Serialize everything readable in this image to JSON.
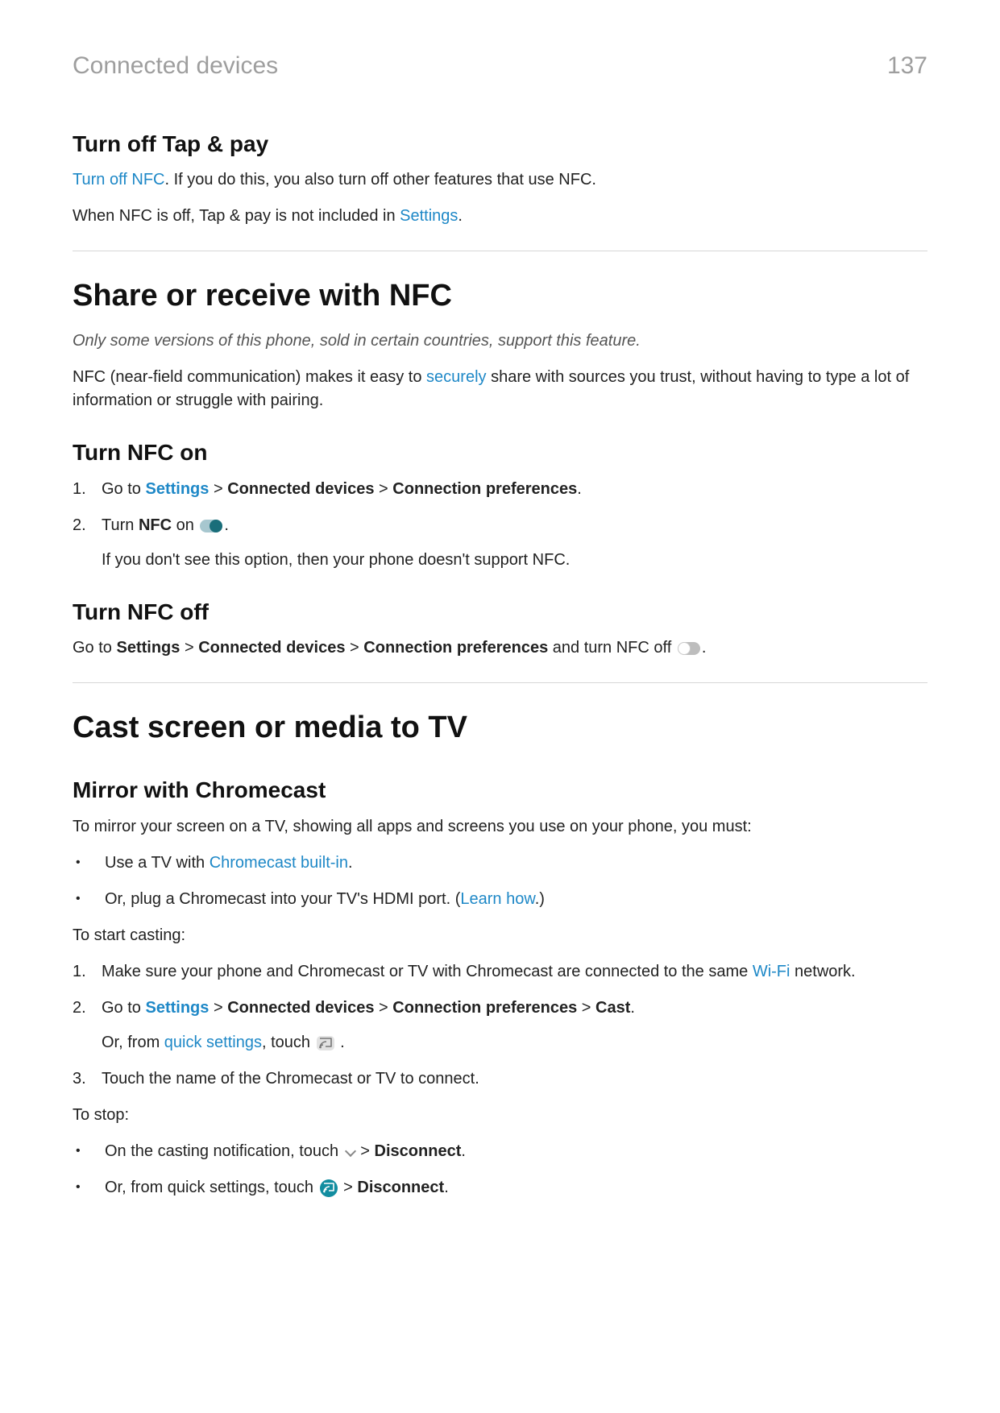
{
  "header": {
    "title": "Connected devices",
    "page_number": "137"
  },
  "tap_pay": {
    "heading": "Turn off Tap & pay",
    "p1_link": "Turn off NFC",
    "p1_rest": ". If you do this, you also turn off other features that use NFC.",
    "p2_a": "When NFC is off, Tap & pay is not included in ",
    "p2_link": "Settings",
    "p2_b": "."
  },
  "share_nfc": {
    "title": "Share or receive with NFC",
    "note": "Only some versions of this phone, sold in certain countries, support this feature.",
    "intro_a": "NFC (near-field communication) makes it easy to ",
    "intro_link": "securely",
    "intro_b": " share with sources you trust, without having to type a lot of information or struggle with pairing.",
    "turn_on": {
      "heading": "Turn NFC on",
      "step1_a": "Go to ",
      "step1_settings": "Settings",
      "step1_cd": "Connected devices",
      "step1_cp": "Connection preferences",
      "step2_a": "Turn ",
      "step2_nfc": "NFC",
      "step2_b": " on ",
      "step2_sub": "If you don't see this option, then your phone doesn't support NFC."
    },
    "turn_off": {
      "heading": "Turn NFC off",
      "a": "Go to ",
      "settings": "Settings",
      "cd": "Connected devices",
      "cp": "Connection preferences",
      "b": " and turn NFC off "
    }
  },
  "cast": {
    "title": "Cast screen or media to TV",
    "mirror_heading": "Mirror with Chromecast",
    "intro": "To mirror your screen on a TV, showing all apps and screens you use on your phone, you must:",
    "bul1_a": "Use a TV with ",
    "bul1_link": "Chromecast built-in",
    "bul1_b": ".",
    "bul2_a": "Or, plug a Chromecast into your TV's HDMI port. (",
    "bul2_link": "Learn how",
    "bul2_b": ".)",
    "start": "To start casting:",
    "s1_a": "Make sure your phone and Chromecast or TV with Chromecast are connected to the same ",
    "s1_link": "Wi-Fi",
    "s1_b": " network.",
    "s2_a": "Go to ",
    "s2_settings": "Settings",
    "s2_cd": "Connected devices",
    "s2_cp": "Connection preferences",
    "s2_cast": "Cast",
    "s2_sub_a": "Or, from ",
    "s2_sub_link": "quick settings",
    "s2_sub_b": ", touch ",
    "s3": "Touch the name of the Chromecast or TV to connect.",
    "stop": "To stop:",
    "stop1_a": "On the casting notification, touch ",
    "stop1_b": " > ",
    "stop1_c": "Disconnect",
    "stop2_a": "Or, from quick settings, touch ",
    "stop2_b": " > ",
    "stop2_c": "Disconnect"
  },
  "glyphs": {
    "gt": " > ",
    "dot": "."
  }
}
